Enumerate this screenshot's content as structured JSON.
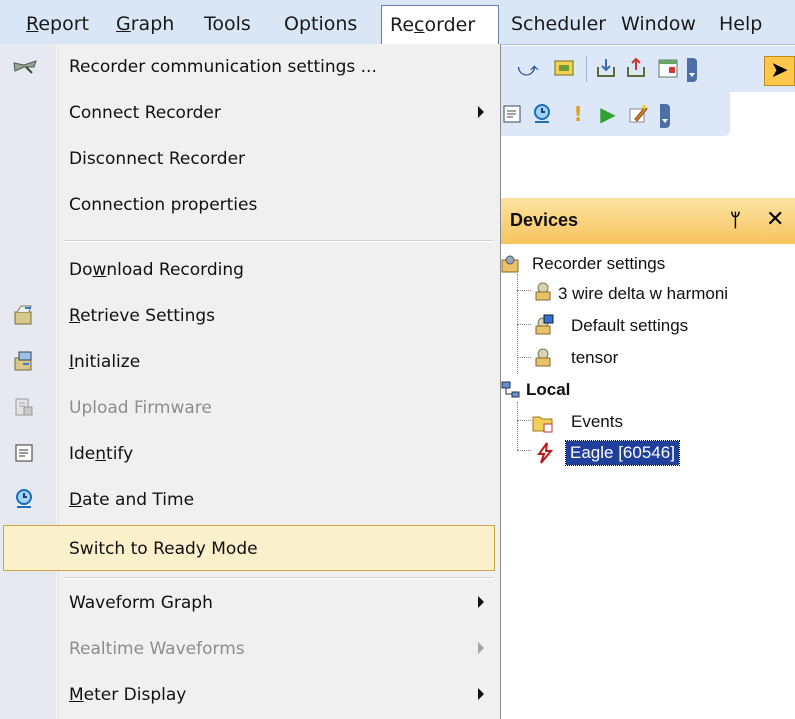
{
  "menubar": {
    "items": [
      {
        "pre": "",
        "acc": "R",
        "post": "eport"
      },
      {
        "pre": "",
        "acc": "G",
        "post": "raph"
      },
      {
        "pre": "Tools",
        "acc": "",
        "post": ""
      },
      {
        "pre": "Options",
        "acc": "",
        "post": ""
      },
      {
        "pre": "Re",
        "acc": "c",
        "post": "order"
      },
      {
        "pre": "Scheduler",
        "acc": "",
        "post": ""
      },
      {
        "pre": "Window",
        "acc": "",
        "post": ""
      },
      {
        "pre": "Help",
        "acc": "",
        "post": ""
      }
    ],
    "active_index": 4
  },
  "menu": {
    "items": [
      {
        "pre": "Recorder communication settings ...",
        "acc": "",
        "post": "",
        "icon": "wrench-plug-icon",
        "submenu": false,
        "disabled": false
      },
      {
        "pre": "Connect Recorder",
        "acc": "",
        "post": "",
        "icon": "",
        "submenu": true,
        "disabled": false
      },
      {
        "pre": "Disconnect Recorder",
        "acc": "",
        "post": "",
        "icon": "",
        "submenu": false,
        "disabled": false
      },
      {
        "pre": "Connection properties",
        "acc": "",
        "post": "",
        "icon": "",
        "submenu": false,
        "disabled": false
      },
      {
        "pre": "Do",
        "acc": "w",
        "post": "nload Recording",
        "icon": "",
        "submenu": false,
        "disabled": false
      },
      {
        "pre": "",
        "acc": "R",
        "post": "etrieve Settings",
        "icon": "retrieve-settings-icon",
        "submenu": false,
        "disabled": false
      },
      {
        "pre": "",
        "acc": "I",
        "post": "nitialize",
        "icon": "initialize-icon",
        "submenu": false,
        "disabled": false
      },
      {
        "pre": "Upload Firmware",
        "acc": "",
        "post": "",
        "icon": "upload-firmware-icon",
        "submenu": false,
        "disabled": true
      },
      {
        "pre": "Ide",
        "acc": "n",
        "post": "tify",
        "icon": "identify-icon",
        "submenu": false,
        "disabled": false
      },
      {
        "pre": "",
        "acc": "D",
        "post": "ate and Time",
        "icon": "clock-icon",
        "submenu": false,
        "disabled": false
      },
      {
        "pre": "Switch to Ready Mode",
        "acc": "",
        "post": "",
        "icon": "",
        "submenu": false,
        "disabled": false
      },
      {
        "pre": "Waveform Graph",
        "acc": "",
        "post": "",
        "icon": "",
        "submenu": true,
        "disabled": false
      },
      {
        "pre": "Realtime Waveforms",
        "acc": "",
        "post": "",
        "icon": "",
        "submenu": true,
        "disabled": true
      },
      {
        "pre": "",
        "acc": "M",
        "post": "eter Display",
        "icon": "",
        "submenu": true,
        "disabled": false
      }
    ],
    "highlighted_index": 10
  },
  "devices": {
    "title": "Devices",
    "pin_glyph": "ᛘ",
    "close_glyph": "✕",
    "tree": [
      {
        "label": "Recorder settings",
        "bold": false,
        "selected": false
      },
      {
        "label": "3 wire delta w harmoni",
        "bold": false,
        "selected": false
      },
      {
        "label": "Default settings",
        "bold": false,
        "selected": false
      },
      {
        "label": "tensor",
        "bold": false,
        "selected": false
      },
      {
        "label": "Local",
        "bold": true,
        "selected": false
      },
      {
        "label": "Events",
        "bold": false,
        "selected": false
      },
      {
        "label": "Eagle [60546]",
        "bold": false,
        "selected": true
      }
    ]
  },
  "colors": {
    "menubar_bg": "#d9e6f6",
    "highlight_bg": "#fbf0cc",
    "highlight_border": "#d0a645",
    "selected_node_bg": "#1f3f9a",
    "devices_header": "#f7c35d"
  }
}
